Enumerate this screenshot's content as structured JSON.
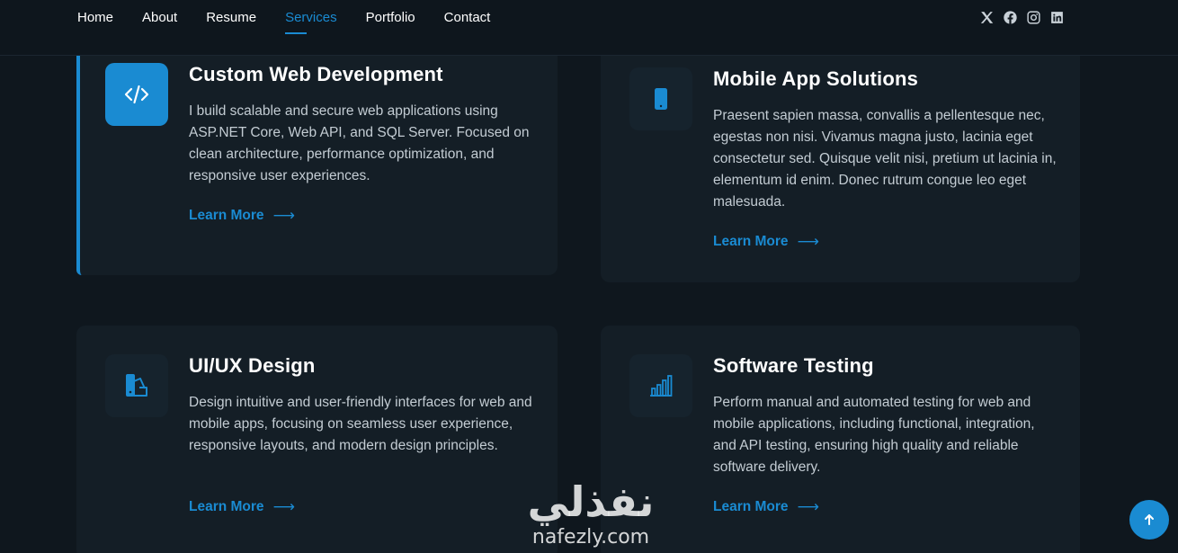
{
  "nav": {
    "items": [
      {
        "label": "Home"
      },
      {
        "label": "About"
      },
      {
        "label": "Resume"
      },
      {
        "label": "Services",
        "active": true
      },
      {
        "label": "Portfolio"
      },
      {
        "label": "Contact"
      }
    ]
  },
  "socials": [
    {
      "icon": "x-twitter-icon"
    },
    {
      "icon": "facebook-icon"
    },
    {
      "icon": "instagram-icon"
    },
    {
      "icon": "linkedin-icon"
    }
  ],
  "services": [
    {
      "title": "Custom Web Development",
      "description": "I build scalable and secure web applications using ASP.NET Core, Web API, and SQL Server. Focused on clean architecture, performance optimization, and responsive user experiences.",
      "link": "Learn More",
      "icon": "code-icon"
    },
    {
      "title": "Mobile App Solutions",
      "description": "Praesent sapien massa, convallis a pellentesque nec, egestas non nisi. Vivamus magna justo, lacinia eget consectetur sed. Quisque velit nisi, pretium ut lacinia in, elementum id enim. Donec rutrum congue leo eget malesuada.",
      "link": "Learn More",
      "icon": "phone-icon"
    },
    {
      "title": "UI/UX Design",
      "description": "Design intuitive and user-friendly interfaces for web and mobile apps, focusing on seamless user experience, responsive layouts, and modern design principles.",
      "link": "Learn More",
      "icon": "palette-swatch-icon"
    },
    {
      "title": "Software Testing",
      "description": "Perform manual and automated testing for web and mobile applications, including functional, integration, and API testing, ensuring high quality and reliable software delivery.",
      "link": "Learn More",
      "icon": "bar-chart-icon"
    }
  ],
  "watermark": {
    "arabic": "نفذلي",
    "latin": "nafezly.com"
  },
  "colors": {
    "accent": "#1a8bd2",
    "background": "#0f171e",
    "card": "#141e26"
  }
}
